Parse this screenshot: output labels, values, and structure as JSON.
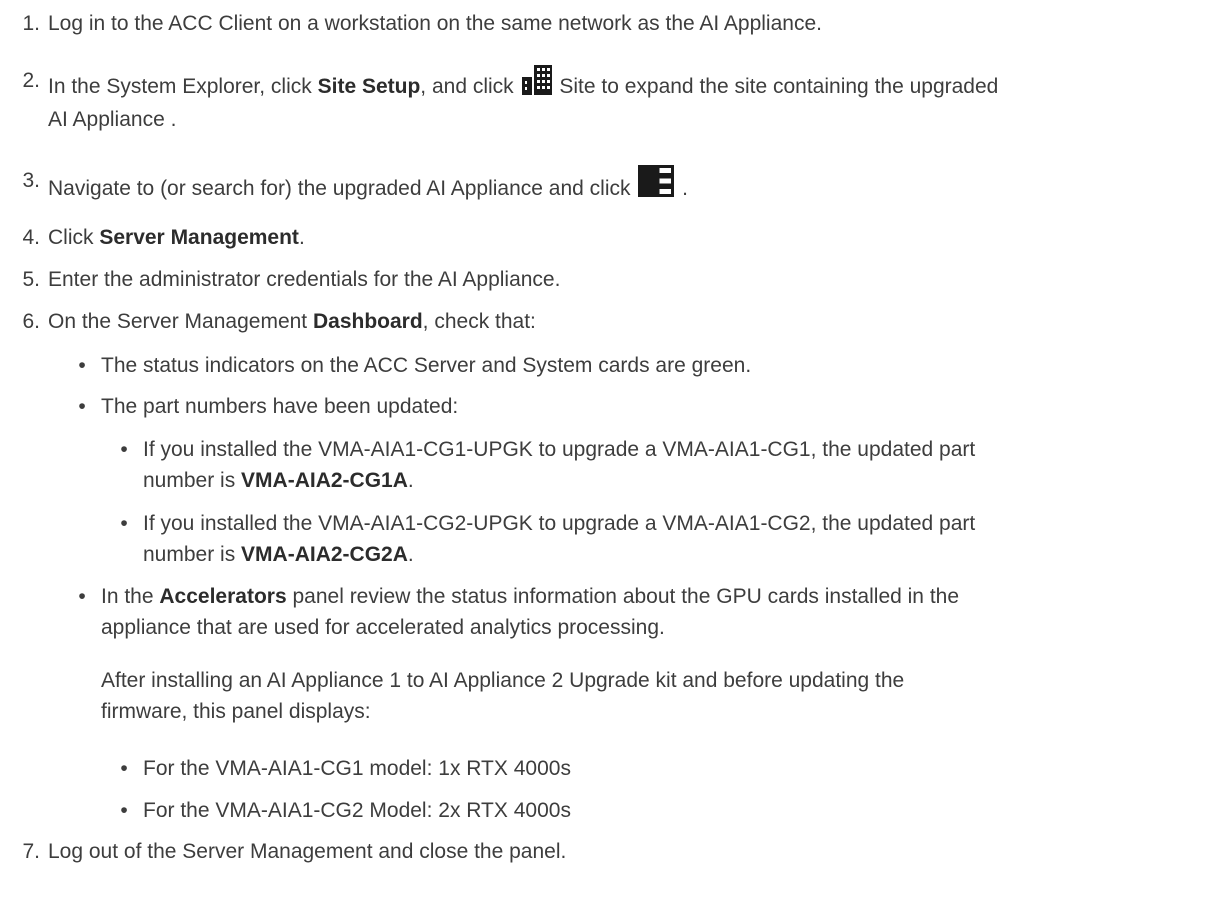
{
  "steps": [
    {
      "num": "1.",
      "text": "Log in to the ACC Client on a workstation on the same network as the AI Appliance."
    },
    {
      "num": "2.",
      "pre": "In the System Explorer, click ",
      "bold": "Site Setup",
      "mid": ", and click ",
      "icon": "building-icon",
      "post1": " Site to expand the site containing the upgraded",
      "post2": "AI Appliance ."
    },
    {
      "num": "3.",
      "pre": "Navigate to (or search for) the upgraded AI Appliance and click ",
      "icon": "server-icon",
      "post": " ."
    },
    {
      "num": "4.",
      "pre": "Click ",
      "bold": "Server Management",
      "post": "."
    },
    {
      "num": "5.",
      "text": "Enter the administrator credentials for the AI Appliance."
    },
    {
      "num": "6.",
      "pre": "On the Server Management ",
      "bold": "Dashboard",
      "post": ", check that:"
    },
    {
      "num": "7.",
      "text": "Log out of the Server Management and close the panel."
    }
  ],
  "bullets": {
    "status": "The status indicators on the ACC Server and System cards are green.",
    "part_numbers": "The part numbers have been updated:",
    "cg1_line1": "If you installed the VMA-AIA1-CG1-UPGK to upgrade a VMA-AIA1-CG1, the updated part",
    "cg1_pre": "number is ",
    "cg1_bold": "VMA-AIA2-CG1A",
    "cg1_post": ".",
    "cg2_line1": "If you installed the VMA-AIA1-CG2-UPGK to upgrade a VMA-AIA1-CG2, the updated part",
    "cg2_pre": "number is ",
    "cg2_bold": "VMA-AIA2-CG2A",
    "cg2_post": ".",
    "acc_pre": "In the ",
    "acc_bold": "Accelerators",
    "acc_post": " panel review the status information about the GPU cards installed in the",
    "acc_line2": "appliance that are used for accelerated analytics processing.",
    "after_line1": "After installing an AI Appliance 1 to AI Appliance 2 Upgrade kit and before updating the",
    "after_line2": "firmware, this panel displays:",
    "model_cg1": "For the VMA-AIA1-CG1 model: 1x RTX 4000s",
    "model_cg2": "For the VMA-AIA1-CG2 Model: 2x RTX 4000s"
  },
  "bullet_char": "•",
  "colors": {
    "text": "#3d3d3d",
    "icon": "#1a1a1a"
  }
}
